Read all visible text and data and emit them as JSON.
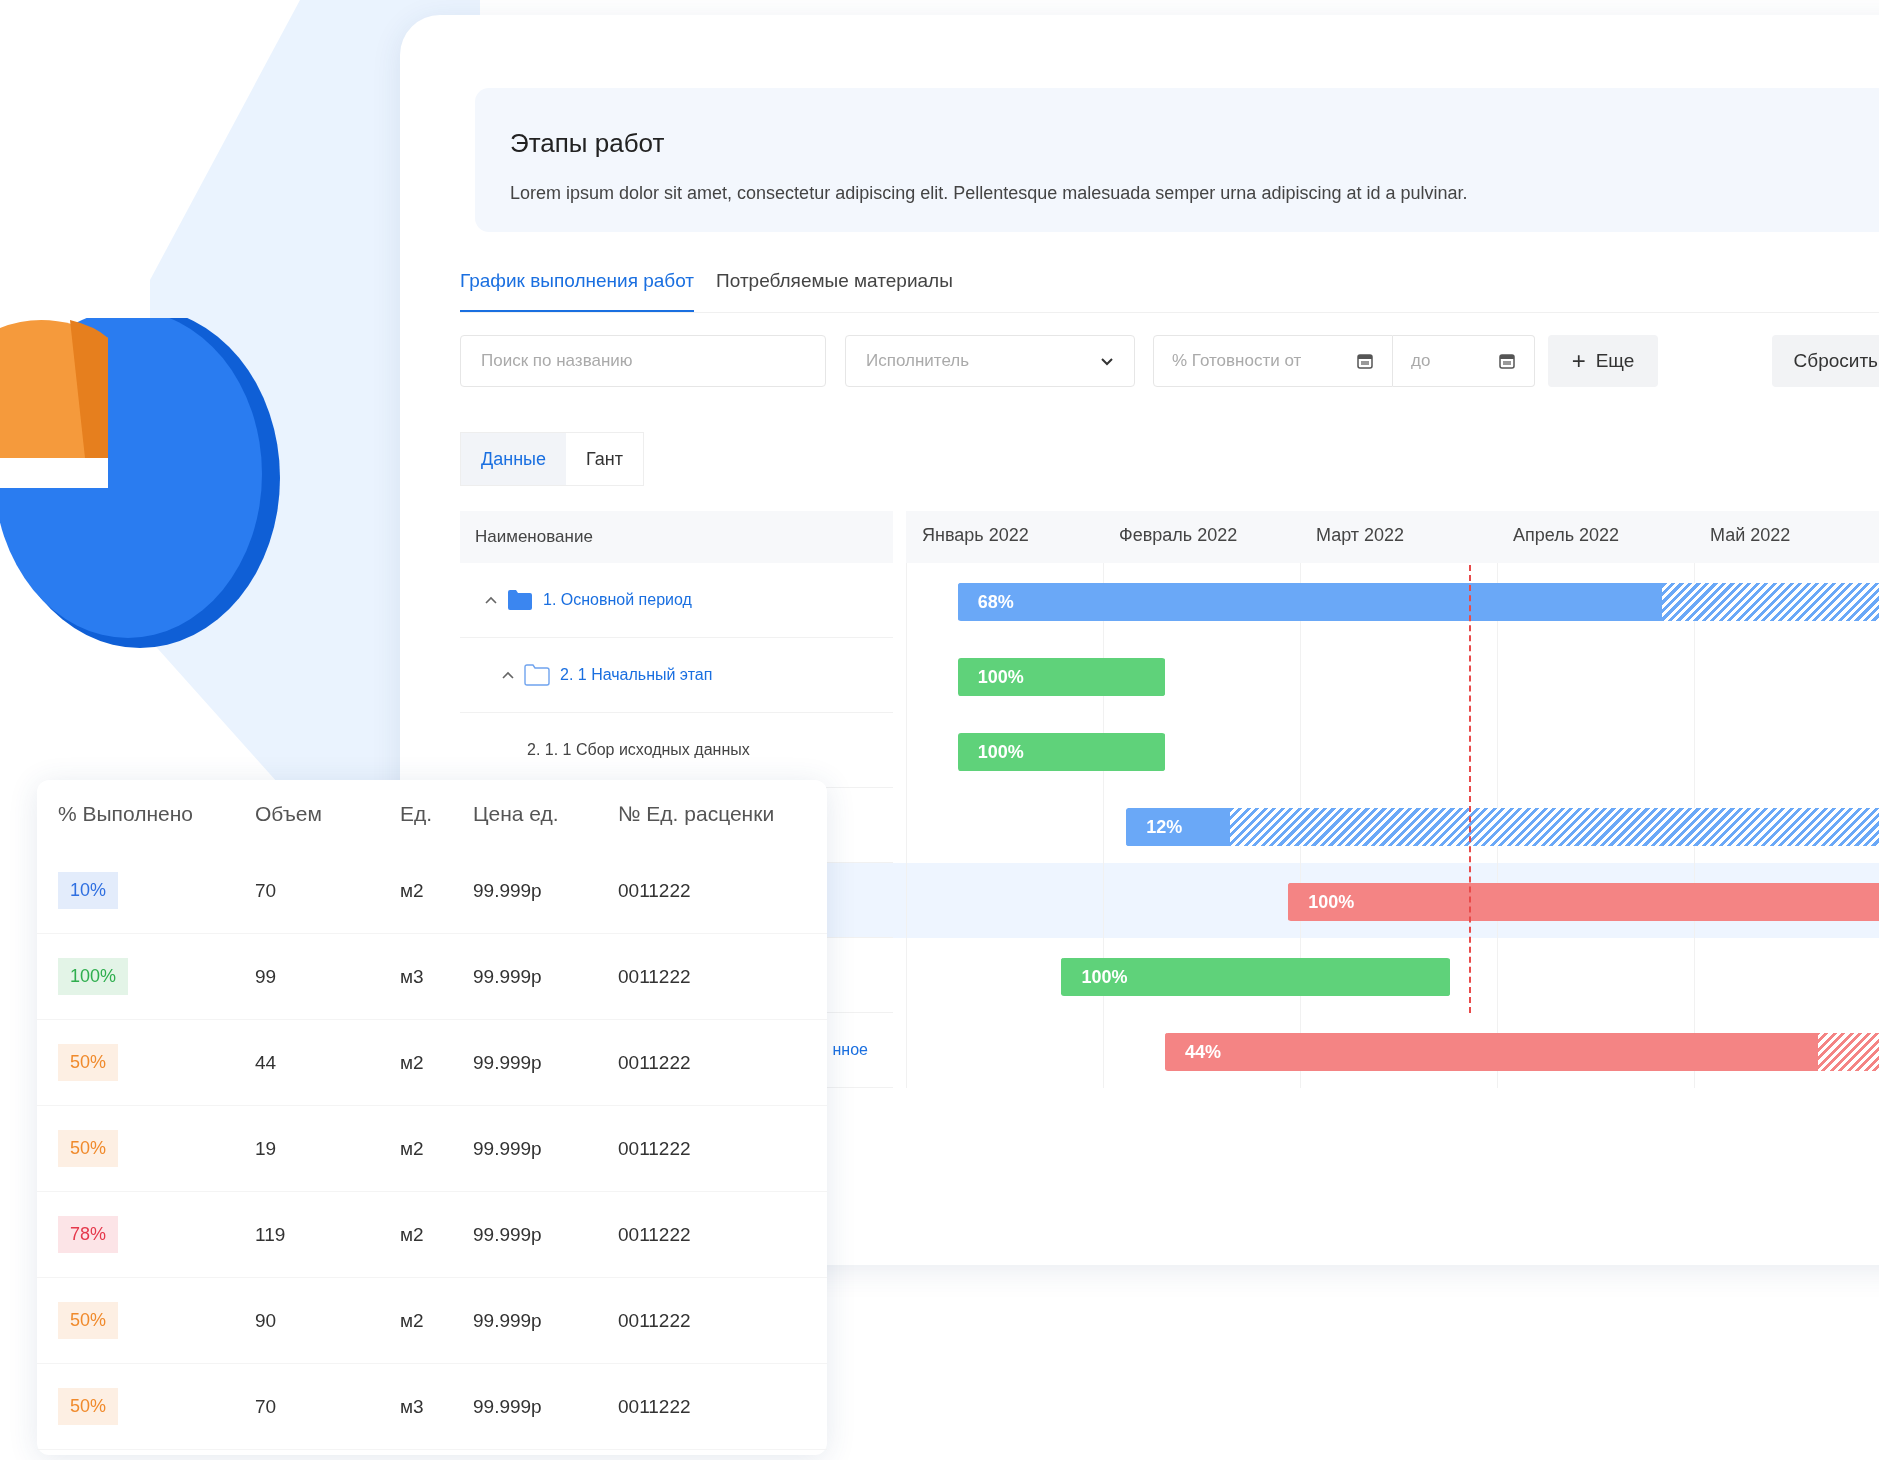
{
  "header": {
    "title": "Этапы работ",
    "description": "Lorem ipsum dolor sit amet, consectetur adipiscing elit. Pellentesque malesuada semper urna adipiscing at id a pulvinar."
  },
  "tabs": [
    {
      "label": "График выполнения работ",
      "selected": true
    },
    {
      "label": "Потребляемые материалы",
      "selected": false
    }
  ],
  "filters": {
    "search": {
      "placeholder": "Поиск по названию"
    },
    "executor": {
      "placeholder": "Исполнитель"
    },
    "readiness_from": {
      "placeholder": "% Готовности от"
    },
    "readiness_to": {
      "placeholder": "до"
    },
    "more_button": {
      "icon": "+",
      "label": "Еще"
    },
    "reset_button": {
      "label": "Сбросить"
    }
  },
  "view_toggle": [
    {
      "label": "Данные",
      "selected": true
    },
    {
      "label": "Гант",
      "selected": false
    }
  ],
  "gantt": {
    "name_column": "Наименование",
    "months": [
      "Январь 2022",
      "Февраль 2022",
      "Март 2022",
      "Апрель 2022",
      "Май 2022"
    ],
    "rows": [
      {
        "kind": "folder",
        "name": "1. Основной период",
        "expanded": true,
        "selected": false,
        "bar": {
          "label": "68%",
          "level": 0.68,
          "color": "#6aa8f7"
        },
        "children": [
          {
            "kind": "folder-outline",
            "name": "2. 1 Начальный этап",
            "expanded": true,
            "selected": false,
            "bar": {
              "label": "100%",
              "level": 1,
              "color": "#5fd27a"
            },
            "children": [
              {
                "kind": "task",
                "name": "2. 1. 1 Сбор исходных данных",
                "selected": false,
                "bar": {
                  "label": "100%",
                  "level": 1,
                  "color": "#5fd27a"
                }
              }
            ]
          }
        ]
      },
      {
        "kind": "hidden",
        "selected": false,
        "bar": {
          "label": "12%",
          "level": 0.12,
          "color": "#6aa8f7"
        }
      },
      {
        "kind": "hidden",
        "selected": true,
        "bar": {
          "label": "100%",
          "level": 1,
          "color": "#f48484"
        }
      },
      {
        "kind": "hidden",
        "selected": false,
        "bar": {
          "label": "100%",
          "level": 1,
          "color": "#5fd27a"
        }
      },
      {
        "kind": "clipped",
        "name": "нное",
        "selected": false,
        "bar": {
          "label": "44%",
          "level": 0.44,
          "color": "#f48484"
        }
      }
    ]
  },
  "materials": {
    "columns": [
      "% Выполнено",
      "Объем",
      "Ед.",
      "Цена ед.",
      "№ Ед. расценки"
    ],
    "rows": [
      {
        "done": "10%",
        "color": "#2f6fe0",
        "volume": "70",
        "unit": "м2",
        "price": "99.999р",
        "rate": "0011222"
      },
      {
        "done": "100%",
        "color": "#2fae4e",
        "volume": "99",
        "unit": "м3",
        "price": "99.999р",
        "rate": "0011222"
      },
      {
        "done": "50%",
        "color": "#f08a2c",
        "volume": "44",
        "unit": "м2",
        "price": "99.999р",
        "rate": "0011222"
      },
      {
        "done": "50%",
        "color": "#f08a2c",
        "volume": "19",
        "unit": "м2",
        "price": "99.999р",
        "rate": "0011222"
      },
      {
        "done": "78%",
        "color": "#e5384b",
        "volume": "119",
        "unit": "м2",
        "price": "99.999р",
        "rate": "0011222"
      },
      {
        "done": "50%",
        "color": "#f08a2c",
        "volume": "90",
        "unit": "м2",
        "price": "99.999р",
        "rate": "0011222"
      },
      {
        "done": "50%",
        "color": "#f08a2c",
        "volume": "70",
        "unit": "м3",
        "price": "99.999р",
        "rate": "0011222"
      }
    ]
  }
}
